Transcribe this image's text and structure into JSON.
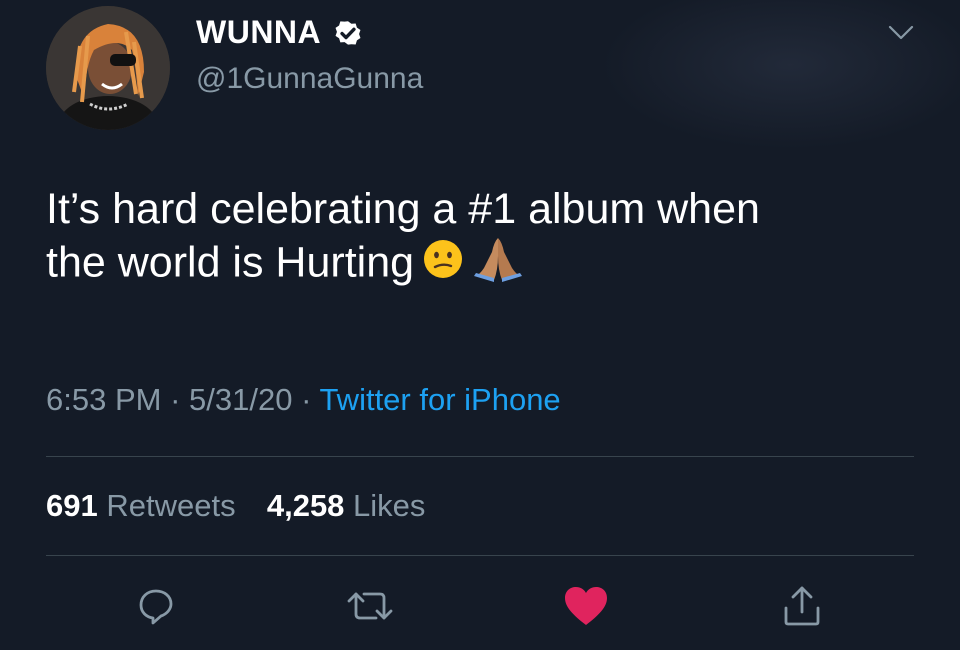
{
  "tweet": {
    "author": {
      "display_name": "WUNNA",
      "handle": "@1GunnaGunna",
      "verified": true
    },
    "text_line1": "It’s hard celebrating a #1 album when",
    "text_line2": "the world is Hurting",
    "emojis": [
      "confused-face",
      "folded-hands"
    ],
    "time": "6:53 PM",
    "date": "5/31/20",
    "separator": " · ",
    "source": "Twitter for iPhone",
    "retweets_count": "691",
    "retweets_label": "Retweets",
    "likes_count": "4,258",
    "likes_label": "Likes",
    "liked": true
  },
  "actions": [
    {
      "icon": "reply-icon"
    },
    {
      "icon": "retweet-icon"
    },
    {
      "icon": "heart-icon"
    },
    {
      "icon": "share-icon"
    }
  ],
  "colors": {
    "background": "#141b27",
    "text": "#ffffff",
    "secondary_text": "#8899a6",
    "link": "#1da1f2",
    "like": "#e0245e",
    "divider": "#38444d"
  }
}
